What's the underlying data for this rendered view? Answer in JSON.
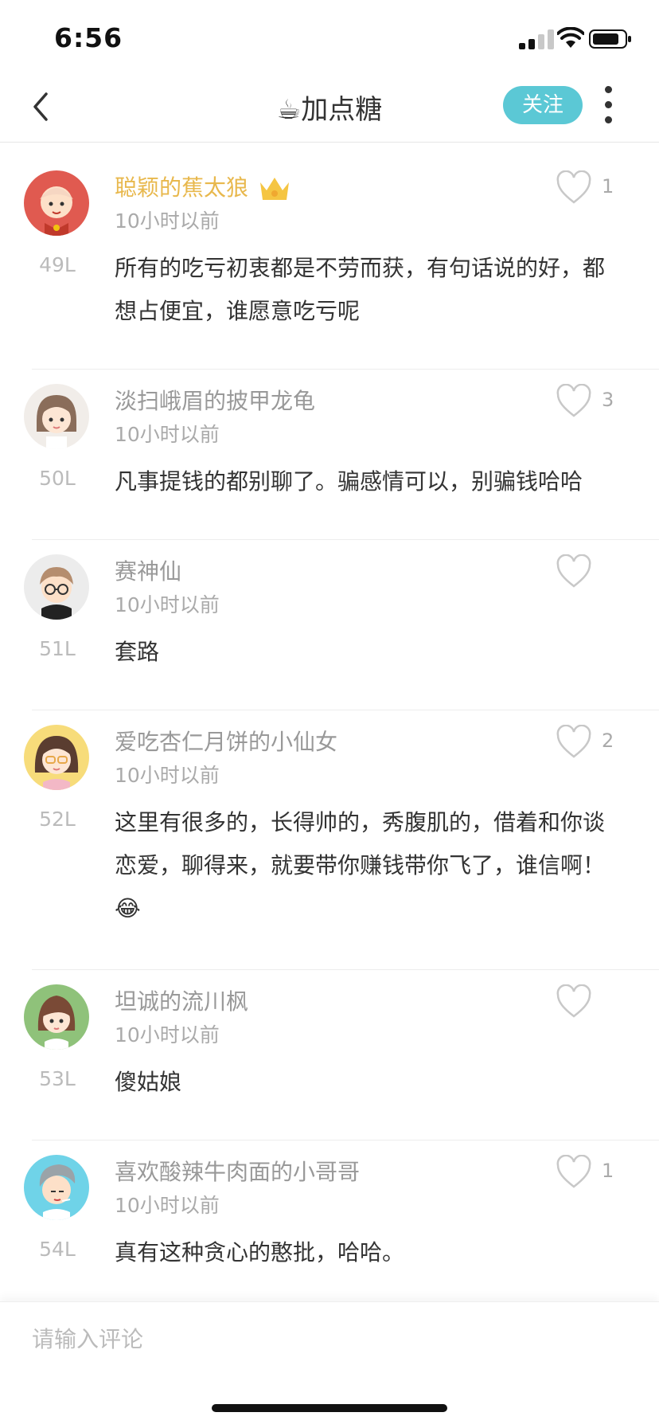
{
  "status_bar": {
    "time": "6:56"
  },
  "header": {
    "title": "☕加点糖",
    "follow_label": "关注"
  },
  "comments": [
    {
      "username": "聪颖的蕉太狼",
      "vip": true,
      "time": "10小时以前",
      "likes": "1",
      "floor": "49L",
      "text": "所有的吃亏初衷都是不劳而获，有句话说的好，都想占便宜，谁愿意吃亏呢"
    },
    {
      "username": "淡扫峨眉的披甲龙龟",
      "vip": false,
      "time": "10小时以前",
      "likes": "3",
      "floor": "50L",
      "text": "凡事提钱的都别聊了。骗感情可以，别骗钱哈哈"
    },
    {
      "username": "赛神仙",
      "vip": false,
      "time": "10小时以前",
      "likes": "",
      "floor": "51L",
      "text": "套路"
    },
    {
      "username": "爱吃杏仁月饼的小仙女",
      "vip": false,
      "time": "10小时以前",
      "likes": "2",
      "floor": "52L",
      "text": "这里有很多的，长得帅的，秀腹肌的，借着和你谈恋爱，聊得来，就要带你赚钱带你飞了，谁信啊！😂"
    },
    {
      "username": "坦诚的流川枫",
      "vip": false,
      "time": "10小时以前",
      "likes": "",
      "floor": "53L",
      "text": "傻姑娘"
    },
    {
      "username": "喜欢酸辣牛肉面的小哥哥",
      "vip": false,
      "time": "10小时以前",
      "likes": "1",
      "floor": "54L",
      "text": "真有这种贪心的憨批，哈哈。"
    }
  ],
  "input": {
    "placeholder": "请输入评论"
  },
  "colors": {
    "accent": "#5bc8d5",
    "vip_name": "#e8b84d",
    "text": "#333333",
    "muted": "#aaaaaa"
  }
}
